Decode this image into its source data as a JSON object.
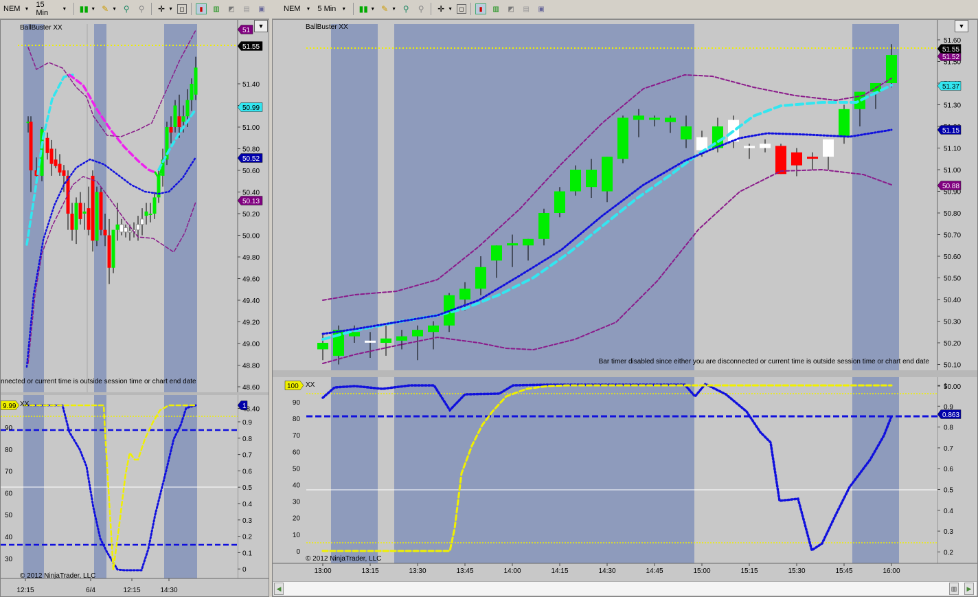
{
  "left_toolbar": {
    "instrument": "NEM",
    "interval": "15 Min",
    "icons": [
      "bars-icon",
      "pencil-icon",
      "zoom-in-icon",
      "zoom-out-icon",
      "crosshair-icon",
      "magnify-icon",
      "chart-style-icon",
      "chart-style2-icon",
      "chart-line-icon",
      "properties-icon",
      "window-icon"
    ]
  },
  "right_toolbar": {
    "instrument": "NEM",
    "interval": "5 Min"
  },
  "left_chart": {
    "title": "BallBuster XX",
    "price_ticks": [
      "51.40",
      "51.20",
      "51.00",
      "50.80",
      "50.60",
      "50.40",
      "50.20",
      "50.00",
      "49.80",
      "49.60",
      "49.40",
      "49.20",
      "49.00",
      "48.80",
      "48.60",
      "48.40"
    ],
    "markers": {
      "top": "51",
      "last": "51.55",
      "cyan": "50.99",
      "blue": "50.52",
      "purple": "50.13"
    },
    "timer_msg": "nnected or current time is outside session time or chart end date",
    "osc_title": "XX",
    "osc_left_ticks": [
      "90",
      "80",
      "70",
      "60",
      "50",
      "40",
      "30"
    ],
    "osc_right_ticks": [
      "0.9",
      "0.8",
      "0.7",
      "0.6",
      "0.5",
      "0.4",
      "0.3",
      "0.2",
      "0.1",
      "0"
    ],
    "osc_markers": {
      "yellow": "9.99",
      "blue": "1"
    },
    "copyright": "© 2012 NinjaTrader, LLC",
    "time_ticks": [
      "12:15",
      "6/4",
      "12:15",
      "14:30"
    ]
  },
  "right_chart": {
    "title": "BallBuster XX",
    "price_ticks": [
      "51.60",
      "51.50",
      "51.40",
      "51.30",
      "51.20",
      "51.10",
      "51.00",
      "50.90",
      "50.80",
      "50.70",
      "50.60",
      "50.50",
      "50.40",
      "50.30",
      "50.20",
      "50.10",
      "50.00"
    ],
    "markers": {
      "last": "51.55",
      "purple_top": "51.52",
      "cyan": "51.37",
      "blue": "51.15",
      "purple_low": "50.88"
    },
    "timer_msg": "Bar timer disabled since either you are disconnected or current time is outside session time or chart end date",
    "osc_title": "XX",
    "osc_left_ticks": [
      "90",
      "80",
      "70",
      "60",
      "50",
      "40",
      "30",
      "20",
      "10",
      "0"
    ],
    "osc_right_ticks": [
      "1",
      "0.9",
      "0.8",
      "0.7",
      "0.6",
      "0.5",
      "0.4",
      "0.3",
      "0.2"
    ],
    "osc_markers": {
      "yellow": "100",
      "blue": "0.863"
    },
    "copyright": "© 2012 NinjaTrader, LLC",
    "time_ticks": [
      "13:00",
      "13:15",
      "13:30",
      "13:45",
      "14:00",
      "14:15",
      "14:30",
      "14:45",
      "15:00",
      "15:15",
      "15:30",
      "15:45",
      "16:00"
    ]
  },
  "colors": {
    "panel_bg": "#c8c8c8",
    "session_band": "#8e9bbc",
    "up_candle": "#00ee00",
    "down_candle": "#ff0000",
    "cyan_line": "#33e6f0",
    "blue_line": "#1010dd",
    "purple_band": "#8a1a8a",
    "magenta_line": "#ee22ee",
    "yellow_line": "#f0f000"
  }
}
